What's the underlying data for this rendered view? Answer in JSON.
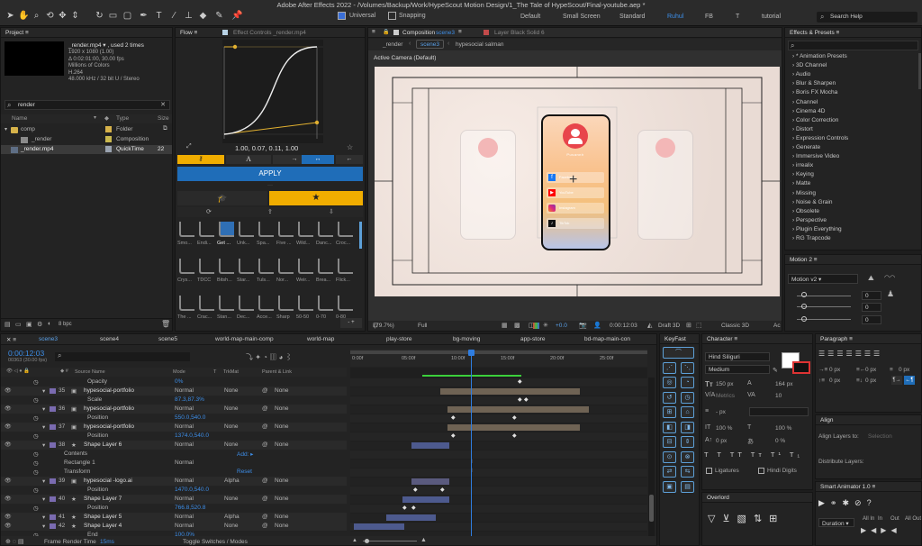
{
  "app": {
    "title": "Adobe After Effects 2022 - /Volumes/Backup/Work/HypeScout Motion Design/1_The Tale of HypeScout/Final-youtube.aep *"
  },
  "toolbar": {
    "universal": "Universal",
    "snapping": "Snapping",
    "workspaces": [
      "Default",
      "Small Screen",
      "Standard",
      "Ruhul",
      "FB",
      "T",
      "tutorial"
    ],
    "search_help": "Search Help"
  },
  "project": {
    "title": "Project",
    "footage_name": "_render.mp4 ▾ , used 2 times",
    "footage_info": [
      "1920 x 1080 (1.00)",
      "Δ 0:02:01:00, 30.00 fps",
      "Millions of Colors",
      "H.264",
      "48.000 kHz / 32 bit U / Stereo"
    ],
    "search_value": "render",
    "columns": [
      "Name",
      "Type",
      "Size"
    ],
    "items": [
      {
        "name": "comp",
        "type": "Folder"
      },
      {
        "name": "_render",
        "type": "Composition"
      },
      {
        "name": "_render.mp4",
        "type": "QuickTime",
        "size": "22"
      }
    ],
    "bpc": "8 bpc"
  },
  "flow": {
    "tab": "Flow",
    "effect_controls": "Effect Controls _render.mp4",
    "values": "1.00, 0.07, 0.11, 1.00",
    "apply": "APPLY",
    "presets_row1": [
      "Smo...",
      "Endi...",
      "Get ...",
      "Unk...",
      "Spa...",
      "Five ...",
      "Wild...",
      "Danc...",
      "Croc..."
    ],
    "presets_row2": [
      "Crys...",
      "TDCC",
      "Bitsh...",
      "Star...",
      "Tuls...",
      "Nor...",
      "Weir...",
      "Brea...",
      "Flick..."
    ],
    "presets_row3": [
      "The ...",
      "Crac...",
      "Stan...",
      "Dec...",
      "Acce...",
      "Sharp",
      "50-50",
      "0-70",
      "0-80"
    ]
  },
  "composition": {
    "tab": "Composition",
    "tab_name": "scene3",
    "layer_tab": "Layer Black Solid 6",
    "crumbs": [
      "_render",
      "scene3",
      "hypesocial salman"
    ],
    "camera": "Active Camera (Default)",
    "zoom": "(79.7%)",
    "quality": "Full",
    "value": "+0.0",
    "timecode": "0:00:12:03",
    "renderer": "Draft 3D",
    "view": "Classic 3D",
    "last": "Ac"
  },
  "phone": {
    "name": "Pusannh",
    "socials": [
      "Facebook",
      "YouTube",
      "Instagram",
      "TikTok"
    ]
  },
  "effects": {
    "title": "Effects & Presets",
    "items": [
      "* Animation Presets",
      "3D Channel",
      "Audio",
      "Blur & Sharpen",
      "Boris FX Mocha",
      "Channel",
      "Cinema 4D",
      "Color Correction",
      "Distort",
      "Expression Controls",
      "Generate",
      "Immersive Video",
      "irrealix",
      "Keying",
      "Matte",
      "Missing",
      "Noise & Grain",
      "Obsolete",
      "Perspective",
      "Plugin Everything",
      "RG Trapcode"
    ]
  },
  "motion": {
    "title": "Motion 2",
    "version": "Motion v2",
    "fields": [
      "0",
      "0",
      "0",
      "0"
    ]
  },
  "timeline": {
    "tabs": [
      "scene3",
      "scene4",
      "scene5",
      "world-map-main-comp",
      "world-map",
      "play-store",
      "bg-moving",
      "app-store",
      "bd-map-main-con"
    ],
    "timecode": "0:00:12:03",
    "fps": "00363 (30.00 fps)",
    "columns": [
      "Source Name",
      "Mode",
      "T",
      "TrkMat",
      "Parent & Link"
    ],
    "ruler": [
      "0:00f",
      "05:00f",
      "10:00f",
      "15:00f",
      "20:00f",
      "25:00f"
    ],
    "rows": [
      {
        "num": "",
        "name": "Opacity",
        "mode": "",
        "trk": "",
        "parent": "",
        "value": "0%",
        "type": "prop"
      },
      {
        "num": "35",
        "name": "hypesocial-portfolio",
        "mode": "Normal",
        "trk": "None",
        "parent": "None",
        "value": "",
        "type": "layer"
      },
      {
        "num": "",
        "name": "Scale",
        "mode": "",
        "trk": "",
        "parent": "",
        "value": "87.3,87.3%",
        "type": "prop"
      },
      {
        "num": "36",
        "name": "hypesocial-portfolio",
        "mode": "Normal",
        "trk": "None",
        "parent": "None",
        "value": "",
        "type": "layer"
      },
      {
        "num": "",
        "name": "Position",
        "mode": "",
        "trk": "",
        "parent": "",
        "value": "550.0,540.0",
        "type": "prop"
      },
      {
        "num": "37",
        "name": "hypesocial-portfolio",
        "mode": "Normal",
        "trk": "None",
        "parent": "None",
        "value": "",
        "type": "layer"
      },
      {
        "num": "",
        "name": "Position",
        "mode": "",
        "trk": "",
        "parent": "",
        "value": "1374.0,540.0",
        "type": "prop"
      },
      {
        "num": "38",
        "name": "Shape Layer 6",
        "mode": "Normal",
        "trk": "None",
        "parent": "None",
        "value": "",
        "type": "layer"
      },
      {
        "num": "",
        "name": "Contents",
        "mode": "",
        "trk": "",
        "parent": "",
        "value": "Add: ▸",
        "type": "group"
      },
      {
        "num": "",
        "name": "Rectangle 1",
        "mode": "Normal",
        "trk": "",
        "parent": "",
        "value": "",
        "type": "group"
      },
      {
        "num": "",
        "name": "Transform",
        "mode": "",
        "trk": "",
        "parent": "",
        "value": "Reset",
        "type": "group"
      },
      {
        "num": "39",
        "name": "hypesocial -logo.ai",
        "mode": "Normal",
        "trk": "Alpha",
        "parent": "None",
        "value": "",
        "type": "layer"
      },
      {
        "num": "",
        "name": "Position",
        "mode": "",
        "trk": "",
        "parent": "",
        "value": "1470.0,540.0",
        "type": "prop"
      },
      {
        "num": "40",
        "name": "Shape Layer 7",
        "mode": "Normal",
        "trk": "None",
        "parent": "None",
        "value": "",
        "type": "layer"
      },
      {
        "num": "",
        "name": "Position",
        "mode": "",
        "trk": "",
        "parent": "",
        "value": "766.8,520.8",
        "type": "prop"
      },
      {
        "num": "41",
        "name": "Shape Layer 5",
        "mode": "Normal",
        "trk": "Alpha",
        "parent": "None",
        "value": "",
        "type": "layer"
      },
      {
        "num": "42",
        "name": "Shape Layer 4",
        "mode": "Normal",
        "trk": "None",
        "parent": "None",
        "value": "",
        "type": "layer"
      },
      {
        "num": "",
        "name": "End",
        "mode": "",
        "trk": "",
        "parent": "",
        "value": "100.0%",
        "type": "prop"
      }
    ],
    "frame_render_label": "Frame Render Time",
    "frame_render_value": "15ms",
    "toggle": "Toggle Switches / Modes"
  },
  "keyfast": {
    "title": "KeyFast"
  },
  "character": {
    "title": "Character",
    "font": "Hind Siliguri",
    "style": "Medium",
    "size": "150 px",
    "leading": "164 px",
    "metrics": "Metrics",
    "tracking": "10",
    "px1": "- px",
    "scale_v": "100 %",
    "scale_h": "100 %",
    "baseline": "0 px",
    "tsume": "0 %",
    "ligatures": "Ligatures",
    "hindi": "Hindi Digits"
  },
  "paragraph": {
    "title": "Paragraph",
    "v1": "0 px",
    "v2": "0 px",
    "v3": "0 px",
    "v4": "0 px",
    "v5": "0 px"
  },
  "align": {
    "title": "Align",
    "to": "Align Layers to:",
    "selection": "Selection",
    "distribute": "Distribute Layers:"
  },
  "overlord": {
    "title": "Overlord"
  },
  "smart": {
    "title": "Smart Animator 1.0",
    "duration": "Duration",
    "all_in": "All In",
    "in": "In",
    "out": "Out",
    "all_out": "All Out"
  }
}
